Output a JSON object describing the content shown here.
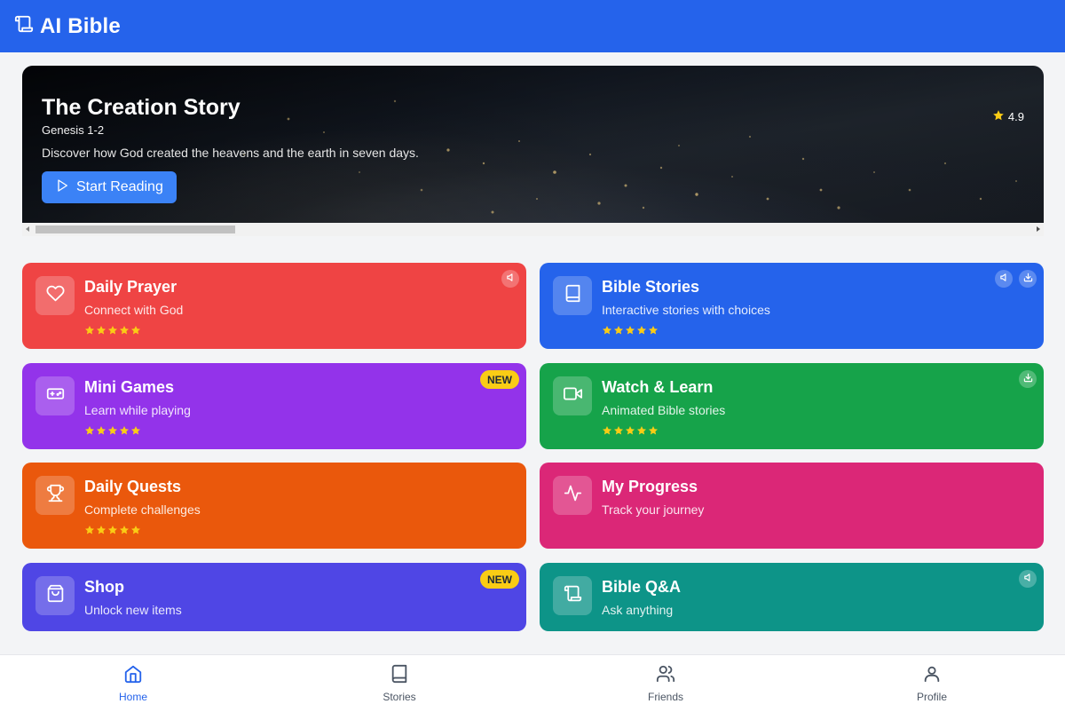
{
  "app": {
    "title": "AI Bible",
    "logo_icon": "scroll-icon"
  },
  "hero": {
    "title": "The Creation Story",
    "reference": "Genesis 1-2",
    "description": "Discover how God created the heavens and the earth in seven days.",
    "button_label": "Start Reading",
    "rating": "4.9"
  },
  "cards": [
    {
      "id": "daily-prayer",
      "title": "Daily Prayer",
      "subtitle": "Connect with God",
      "color": "#ef4444",
      "icon": "heart-icon",
      "stars": 5,
      "badge": "sound"
    },
    {
      "id": "bible-stories",
      "title": "Bible Stories",
      "subtitle": "Interactive stories with choices",
      "color": "#2563eb",
      "icon": "book-icon",
      "stars": 5,
      "badge": "sound-download"
    },
    {
      "id": "mini-games",
      "title": "Mini Games",
      "subtitle": "Learn while playing",
      "color": "#9333ea",
      "icon": "gamepad-icon",
      "stars": 5,
      "badge": "new"
    },
    {
      "id": "watch-learn",
      "title": "Watch & Learn",
      "subtitle": "Animated Bible stories",
      "color": "#16a34a",
      "icon": "video-icon",
      "stars": 5,
      "badge": "download"
    },
    {
      "id": "daily-quests",
      "title": "Daily Quests",
      "subtitle": "Complete challenges",
      "color": "#ea580c",
      "icon": "trophy-icon",
      "stars": 5,
      "badge": "none"
    },
    {
      "id": "my-progress",
      "title": "My Progress",
      "subtitle": "Track your journey",
      "color": "#db2777",
      "icon": "activity-icon",
      "stars": 0,
      "badge": "none"
    },
    {
      "id": "shop",
      "title": "Shop",
      "subtitle": "Unlock new items",
      "color": "#4f46e5",
      "icon": "shopping-bag-icon",
      "stars": 0,
      "badge": "new"
    },
    {
      "id": "bible-qa",
      "title": "Bible Q&A",
      "subtitle": "Ask anything",
      "color": "#0d9488",
      "icon": "scroll-icon",
      "stars": 0,
      "badge": "sound"
    }
  ],
  "badge_new_label": "NEW",
  "nav": [
    {
      "label": "Home",
      "icon": "home-icon",
      "active": true
    },
    {
      "label": "Stories",
      "icon": "book-icon",
      "active": false
    },
    {
      "label": "Friends",
      "icon": "users-icon",
      "active": false
    },
    {
      "label": "Profile",
      "icon": "user-icon",
      "active": false
    }
  ],
  "colors": {
    "header": "#2563eb",
    "star": "#facc15",
    "new_badge": "#facc15",
    "nav_active": "#2563eb"
  }
}
